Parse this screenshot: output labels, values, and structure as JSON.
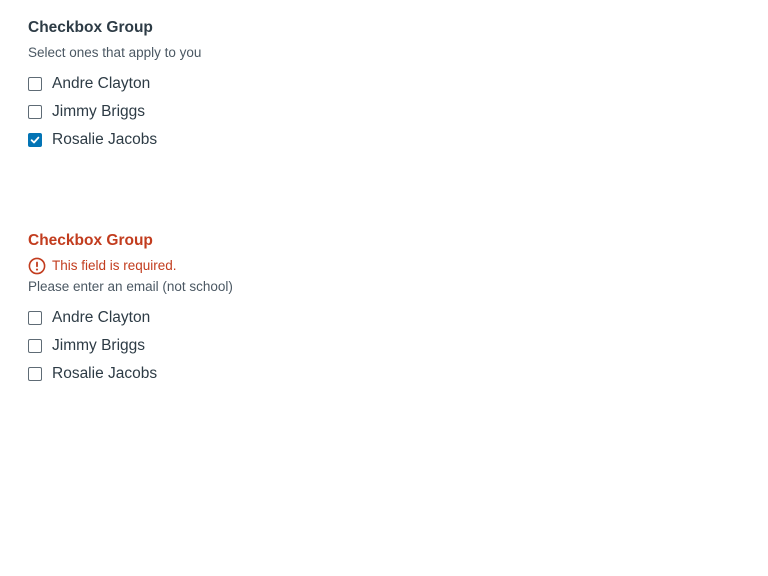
{
  "group1": {
    "label": "Checkbox Group",
    "hint": "Select ones that apply to you",
    "options": [
      {
        "label": "Andre Clayton",
        "checked": false
      },
      {
        "label": "Jimmy Briggs",
        "checked": false
      },
      {
        "label": "Rosalie Jacobs",
        "checked": true
      }
    ]
  },
  "group2": {
    "label": "Checkbox Group",
    "error": "This field is required.",
    "hint": "Please enter an email (not school)",
    "options": [
      {
        "label": "Andre Clayton",
        "checked": false
      },
      {
        "label": "Jimmy Briggs",
        "checked": false
      },
      {
        "label": "Rosalie Jacobs",
        "checked": false
      }
    ]
  },
  "colors": {
    "text": "#2d3b45",
    "error": "#c23c1e",
    "checked": "#0374b5"
  },
  "icons": {
    "error": "exclamation-circle-icon",
    "check": "checkmark-icon"
  }
}
